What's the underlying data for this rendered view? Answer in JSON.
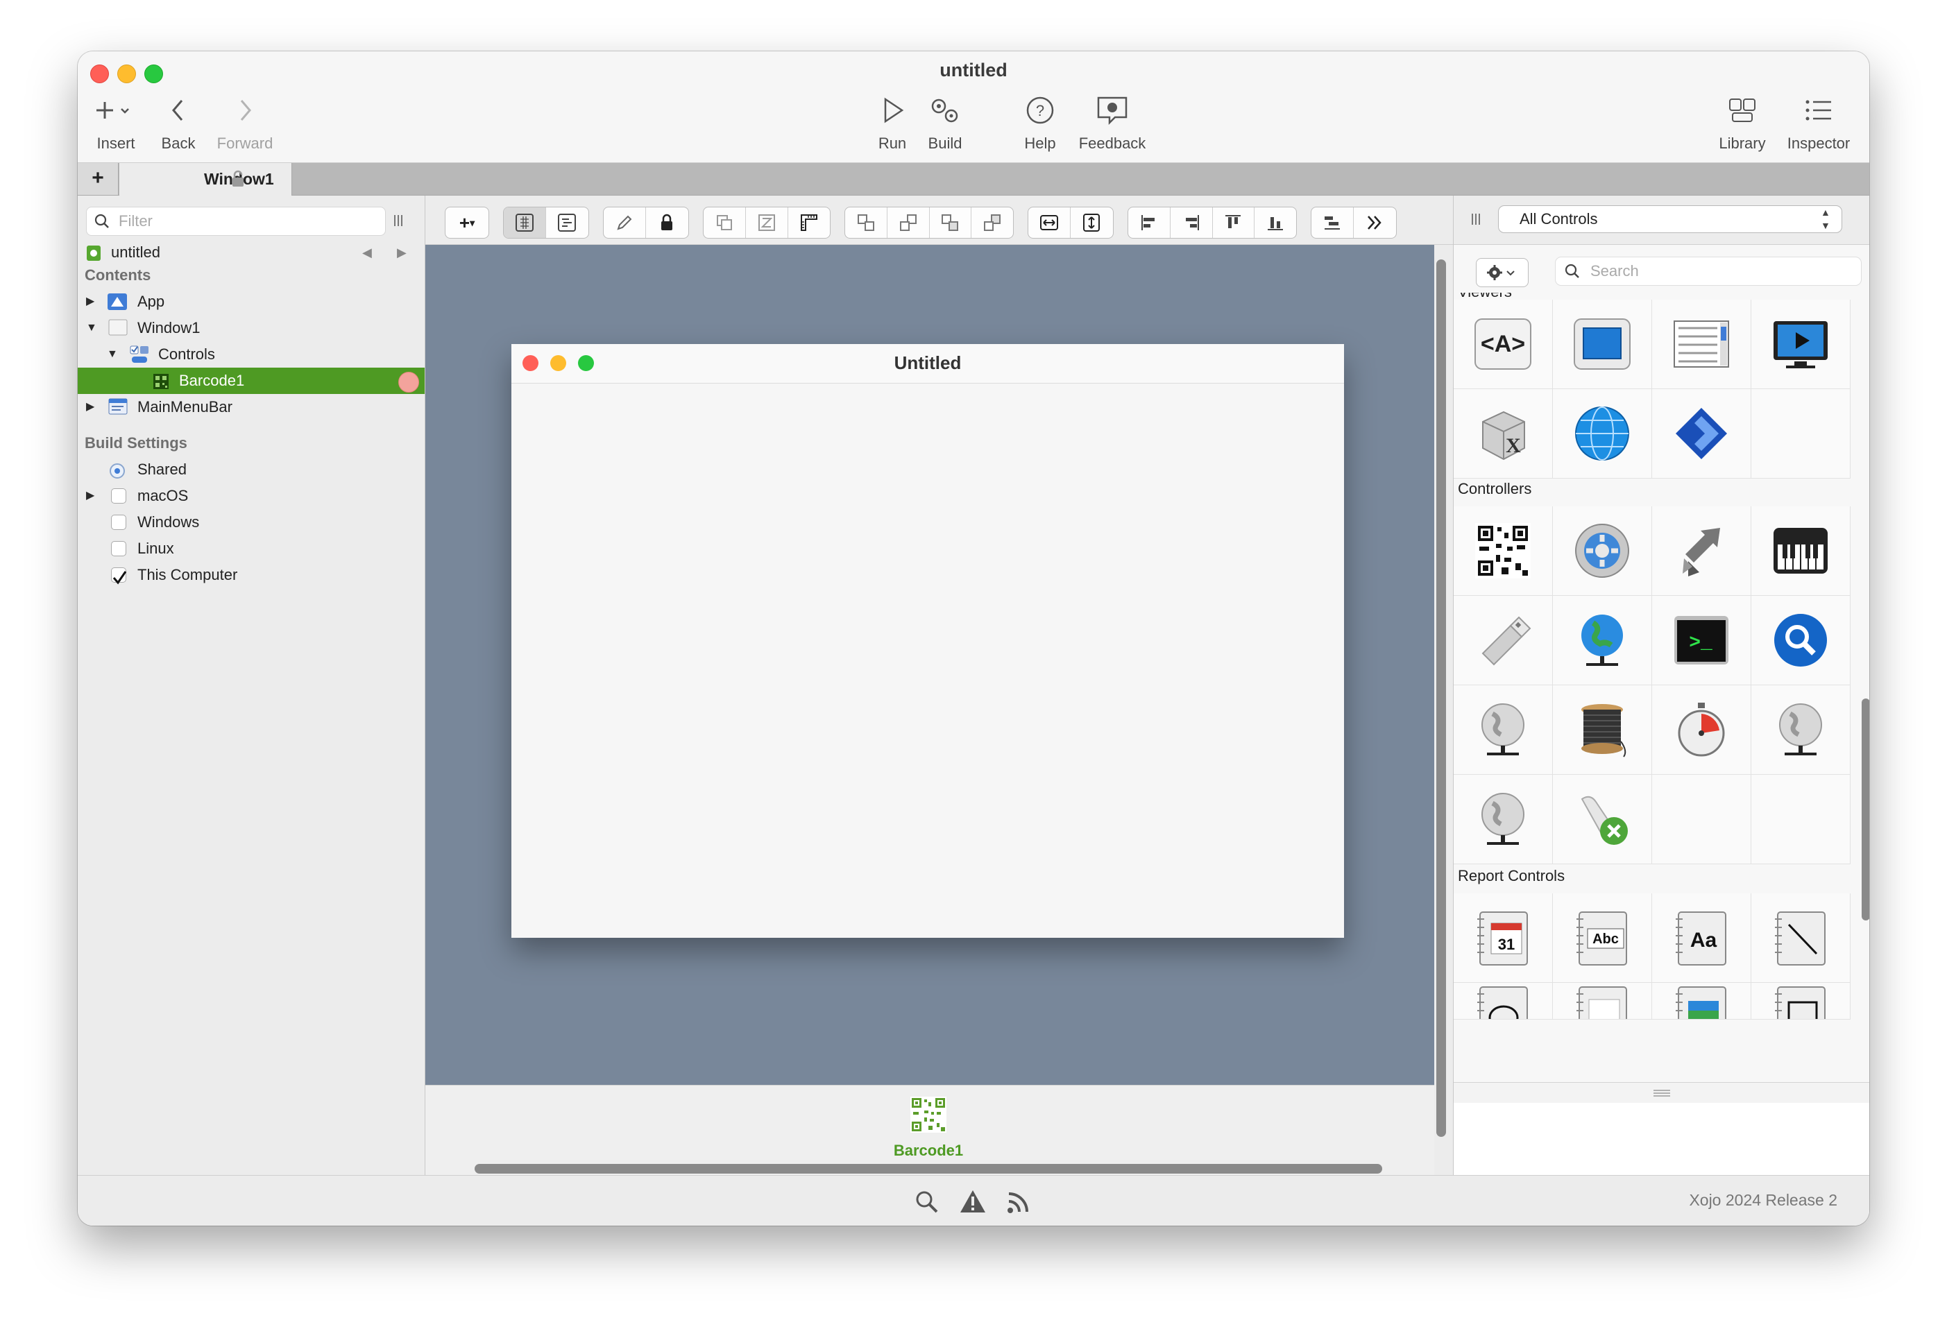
{
  "window": {
    "title": "untitled"
  },
  "toolbar": {
    "insert": "Insert",
    "back": "Back",
    "forward": "Forward",
    "run": "Run",
    "build": "Build",
    "help": "Help",
    "feedback": "Feedback",
    "library": "Library",
    "inspector": "Inspector"
  },
  "tabs": {
    "add": "+",
    "active": "Window1"
  },
  "navigator": {
    "filter_placeholder": "Filter",
    "project": "untitled",
    "contents_header": "Contents",
    "items": {
      "app": "App",
      "window1": "Window1",
      "controls": "Controls",
      "barcode1": "Barcode1",
      "mainmenubar": "MainMenuBar"
    },
    "build_settings_header": "Build Settings",
    "build": {
      "shared": "Shared",
      "macos": "macOS",
      "windows": "Windows",
      "linux": "Linux",
      "this_computer": "This Computer"
    },
    "selected_color": "#4e9a23"
  },
  "designer": {
    "window_title": "Untitled",
    "shelf_item": "Barcode1",
    "canvas_color": "#78879a"
  },
  "library": {
    "filter_value": "All Controls",
    "search_placeholder": "Search",
    "groups": {
      "viewers_partial": "Viewers",
      "controllers": "Controllers",
      "report_controls": "Report Controls"
    },
    "viewer_icons": [
      "html-viewer-icon",
      "canvas-icon",
      "listbox-icon",
      "movie-player-icon",
      "xojo-plugin-icon",
      "web-viewer-icon",
      "desktop-xaml-icon"
    ],
    "controller_icons": [
      "barcode-icon",
      "settings-gear-icon",
      "shell-arrow-icon",
      "piano-midi-icon",
      "usb-serial-icon",
      "network-globe-icon",
      "terminal-icon",
      "spotlight-search-icon",
      "ipc-socket-icon",
      "thread-spool-icon",
      "timer-icon",
      "tcp-socket-icon",
      "udp-socket-icon",
      "xml-scroll-icon"
    ],
    "report_icons": [
      "report-date-icon",
      "report-field-icon",
      "report-label-icon",
      "report-line-icon"
    ],
    "report_icon_text": {
      "date": "31",
      "field": "Abc",
      "label": "Aa"
    }
  },
  "status": {
    "version": "Xojo 2024 Release 2"
  },
  "colors": {
    "close": "#ff5f57",
    "minimize": "#febc2e",
    "zoom": "#28c840",
    "accent": "#4e9a23"
  }
}
